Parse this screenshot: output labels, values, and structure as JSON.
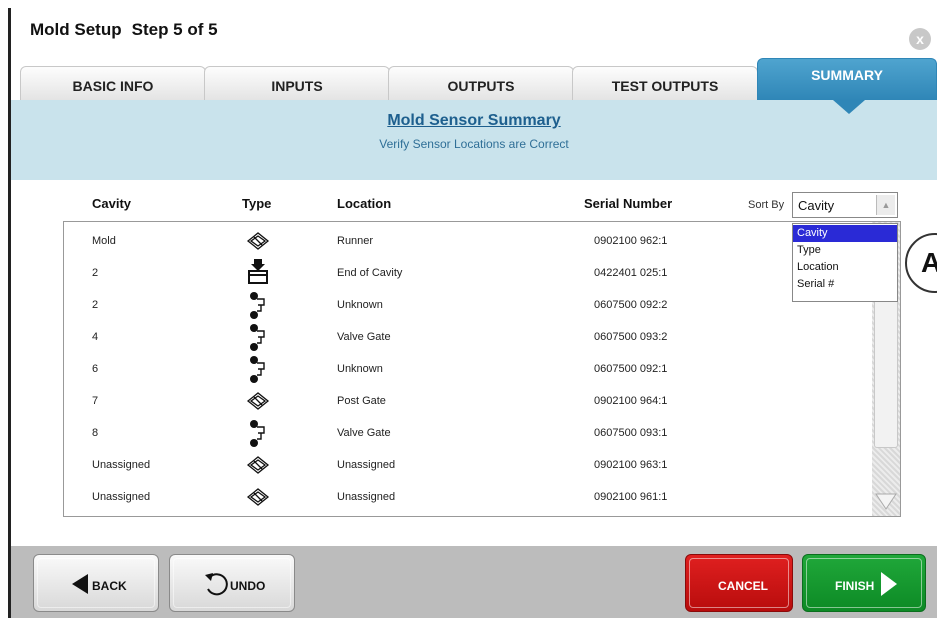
{
  "header": {
    "title": "Mold Setup",
    "step": "Step 5 of 5",
    "close_glyph": "x"
  },
  "tabs": [
    {
      "label": "BASIC INFO"
    },
    {
      "label": "INPUTS"
    },
    {
      "label": "OUTPUTS"
    },
    {
      "label": "TEST OUTPUTS"
    },
    {
      "label": "SUMMARY",
      "active": true
    }
  ],
  "banner": {
    "title": "Mold Sensor Summary",
    "subtitle": "Verify Sensor Locations are Correct"
  },
  "table": {
    "columns": {
      "cavity": "Cavity",
      "type": "Type",
      "location": "Location",
      "serial": "Serial Number"
    },
    "rows": [
      {
        "cavity": "Mold",
        "type": "diamond-sensor-icon",
        "location": "Runner",
        "serial": "0902100 962:1"
      },
      {
        "cavity": "2",
        "type": "cavity-sensor-icon",
        "location": "End of Cavity",
        "serial": "0422401 025:1"
      },
      {
        "cavity": "2",
        "type": "pin-sensor-icon",
        "location": "Unknown",
        "serial": "0607500 092:2"
      },
      {
        "cavity": "4",
        "type": "pin-sensor-icon",
        "location": "Valve Gate",
        "serial": "0607500 093:2"
      },
      {
        "cavity": "6",
        "type": "pin-sensor-icon",
        "location": "Unknown",
        "serial": "0607500 092:1"
      },
      {
        "cavity": "7",
        "type": "diamond-sensor-icon",
        "location": "Post Gate",
        "serial": "0902100 964:1"
      },
      {
        "cavity": "8",
        "type": "pin-sensor-icon",
        "location": "Valve Gate",
        "serial": "0607500 093:1"
      },
      {
        "cavity": "Unassigned",
        "type": "diamond-sensor-icon",
        "location": "Unassigned",
        "serial": "0902100 963:1"
      },
      {
        "cavity": "Unassigned",
        "type": "diamond-sensor-icon",
        "location": "Unassigned",
        "serial": "0902100 961:1"
      }
    ]
  },
  "sort": {
    "label": "Sort By",
    "value": "Cavity",
    "options": [
      "Cavity",
      "Type",
      "Location",
      "Serial #"
    ],
    "selected_index": 0
  },
  "callout": {
    "label": "A"
  },
  "footer": {
    "back": "BACK",
    "undo": "UNDO",
    "cancel": "CANCEL",
    "finish": "FINISH"
  },
  "colors": {
    "accent": "#2f86b7",
    "banner": "#c9e3ec",
    "cancel": "#d01818",
    "finish": "#15962e"
  }
}
